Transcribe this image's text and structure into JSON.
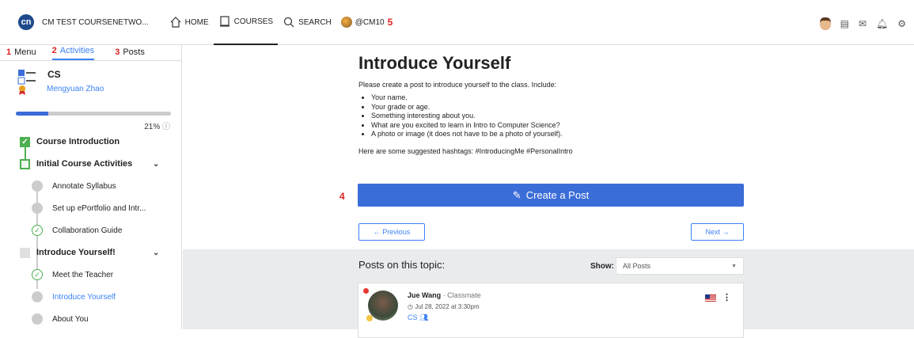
{
  "header": {
    "logo_text": "cn",
    "brand": "CM TEST COURSENETWO...",
    "nav": [
      {
        "label": "HOME"
      },
      {
        "label": "COURSES"
      },
      {
        "label": "SEARCH"
      },
      {
        "label": "@CM10"
      }
    ],
    "marker": "5"
  },
  "sidebar": {
    "tabs": [
      {
        "num": "1",
        "label": "Menu"
      },
      {
        "num": "2",
        "label": "Activities"
      },
      {
        "num": "3",
        "label": "Posts"
      }
    ],
    "course": {
      "name": "CS",
      "teacher": "Mengyuan Zhao"
    },
    "progress_percent": 21,
    "progress_label": "21%",
    "tree": [
      {
        "label": "Course Introduction"
      },
      {
        "label": "Initial Course Activities"
      },
      {
        "label": "Annotate Syllabus"
      },
      {
        "label": "Set up ePortfolio and Intr..."
      },
      {
        "label": "Collaboration Guide"
      },
      {
        "label": "Introduce Yourself!"
      },
      {
        "label": "Meet the Teacher"
      },
      {
        "label": "Introduce Yourself"
      },
      {
        "label": "About You"
      }
    ]
  },
  "main": {
    "title": "Introduce Yourself",
    "intro": "Please create a post to introduce yourself to the class. Include:",
    "bullets": [
      "Your name.",
      "Your grade or age.",
      "Something interesting about you.",
      "What are you excited to learn in Intro to Computer Science?",
      "A photo or image (it does not have to be a photo of yourself)."
    ],
    "hashtags": "Here are some suggested hashtags: #IntroducingMe #PersonalIntro",
    "marker": "4",
    "create_label": "Create a Post",
    "prev_label": "← Previous",
    "next_label": "Next →"
  },
  "posts": {
    "title": "Posts on this topic:",
    "show_label": "Show:",
    "filter_value": "All Posts",
    "items": [
      {
        "name": "Jue Wang",
        "role": "· Classmate",
        "date": "Jul 28, 2022 at 3:30pm",
        "tag": "CS"
      }
    ]
  }
}
